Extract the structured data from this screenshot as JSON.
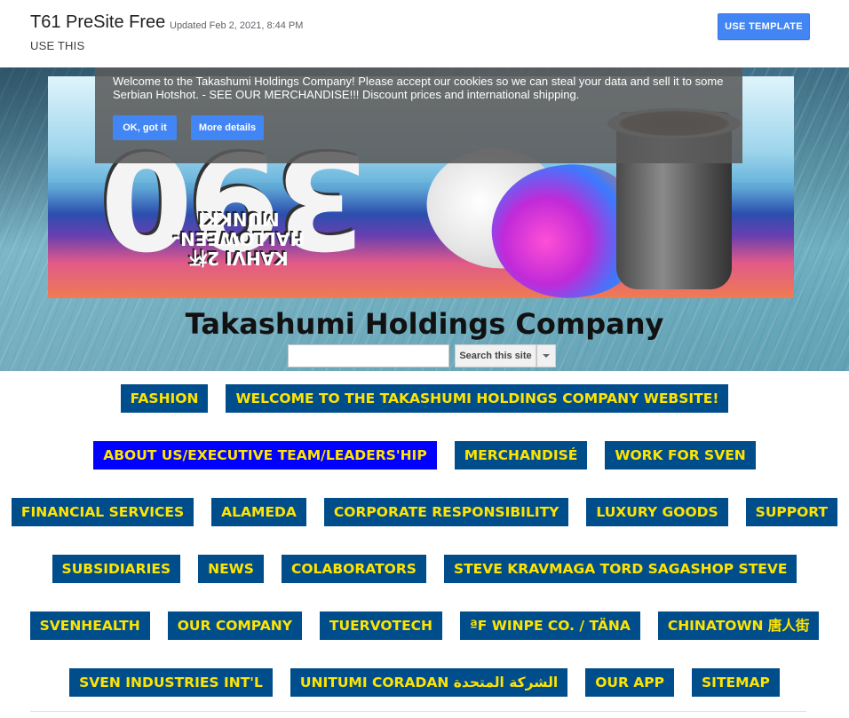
{
  "template": {
    "title": "T61 PreSite Free",
    "updated": "Updated Feb 2, 2021, 8:44 PM",
    "use_this": "USE THIS",
    "use_template_label": "USE TEMPLATE"
  },
  "cookie_banner": {
    "text": "Welcome to the Takashumi Holdings Company! Please accept our cookies so we can steal your data and sell it to some Serbian Hotshot. - SEE OUR MERCHANDISE!!! Discount prices and international shipping.",
    "ok_label": "OK, got it",
    "more_label": "More details"
  },
  "banner_image": {
    "big_number": "390",
    "lines": [
      "KAHVI 2杯",
      "HALLOWEEN-",
      "MUNKKI"
    ]
  },
  "site": {
    "title": "Takashumi Holdings Company",
    "search_placeholder": "",
    "search_button": "Search this site"
  },
  "colors": {
    "nav_bg": "#004d8c",
    "nav_text": "#ffe400",
    "nav_active_bg": "#0000ff",
    "accent_button": "#4285f4"
  },
  "nav": {
    "rows": [
      [
        "FASHION",
        "WELCOME TO THE TAKASHUMI HOLDINGS COMPANY WEBSITE!"
      ],
      [
        "ABOUT US/EXECUTIVE TEAM/LEADERS'HIP",
        "MERCHANDISÉ",
        "WORK FOR SVEN"
      ],
      [
        "FINANCIAL SERVICES",
        "ALAMEDA",
        "CORPORATE RESPONSIBILITY",
        "LUXURY GOODS",
        "SUPPORT"
      ],
      [
        "SUBSIDIARIES",
        "NEWS",
        "COLABORATORS",
        "STEVE KRAVMAGA TORD SAGASHOP STEVE"
      ],
      [
        "SVENHEALTH",
        "OUR COMPANY",
        "TUERVOTECH",
        "ªF WINPE CO. / TÄNA",
        "CHINATOWN 唐人街"
      ],
      [
        "SVEN INDUSTRIES INT'L",
        "UNITUMI CORADAN الشركة المتحدة",
        "OUR APP",
        "SITEMAP"
      ]
    ],
    "active": "ABOUT US/EXECUTIVE TEAM/LEADERS'HIP"
  }
}
